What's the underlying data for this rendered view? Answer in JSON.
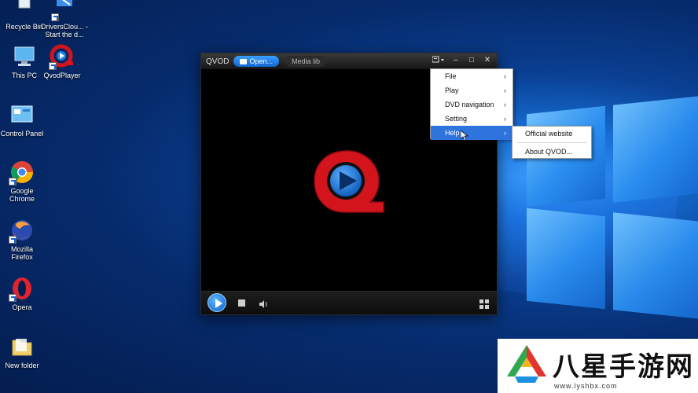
{
  "desktop": {
    "icons": [
      {
        "label": "Recycle Bin"
      },
      {
        "label": "DriversClou... - Start the d..."
      },
      {
        "label": "This PC"
      },
      {
        "label": "QvodPlayer"
      },
      {
        "label": "Control Panel"
      },
      {
        "label": "Google Chrome"
      },
      {
        "label": "Mozilla Firefox"
      },
      {
        "label": "Opera"
      },
      {
        "label": "New folder"
      }
    ]
  },
  "player": {
    "brand": "QVOD",
    "open_label": "Open...",
    "media_lib_label": "Media lib",
    "window_controls": {
      "minimize": "–",
      "maximize": "□",
      "close": "✕"
    }
  },
  "main_menu": {
    "items": [
      {
        "label": "File",
        "arrow": "›"
      },
      {
        "label": "Play",
        "arrow": "›"
      },
      {
        "label": "DVD navigation",
        "arrow": "›"
      },
      {
        "label": "Setting",
        "arrow": "›"
      },
      {
        "label": "Help",
        "arrow": "›"
      }
    ]
  },
  "help_submenu": {
    "items": [
      {
        "label": "Official website"
      },
      {
        "label": "About QVOD..."
      }
    ]
  },
  "watermark": {
    "title": "八星手游网",
    "url": "www.lyshbx.com"
  },
  "colors": {
    "menu_highlight": "#2f73dc",
    "qvod_red": "#d4141c",
    "qvod_blue": "#1e7fe0"
  }
}
